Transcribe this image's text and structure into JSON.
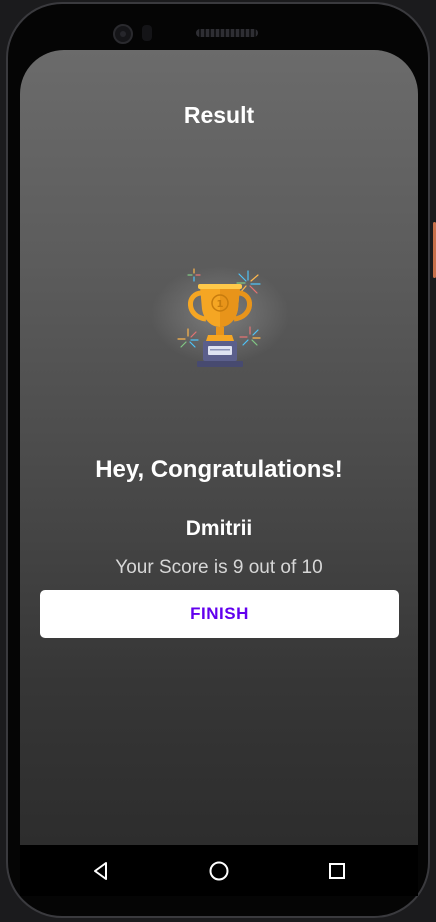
{
  "header": {
    "title": "Result"
  },
  "trophy": {
    "icon": "trophy-icon",
    "color": "#f5a623"
  },
  "result": {
    "greeting": "Hey, Congratulations!",
    "name": "Dmitrii",
    "score_text": "Your Score is 9 out of 10"
  },
  "actions": {
    "finish_label": "FINISH",
    "finish_color": "#6200ee"
  },
  "navbar": {
    "back_icon": "back-triangle-icon",
    "home_icon": "home-circle-icon",
    "recents_icon": "recents-square-icon"
  }
}
